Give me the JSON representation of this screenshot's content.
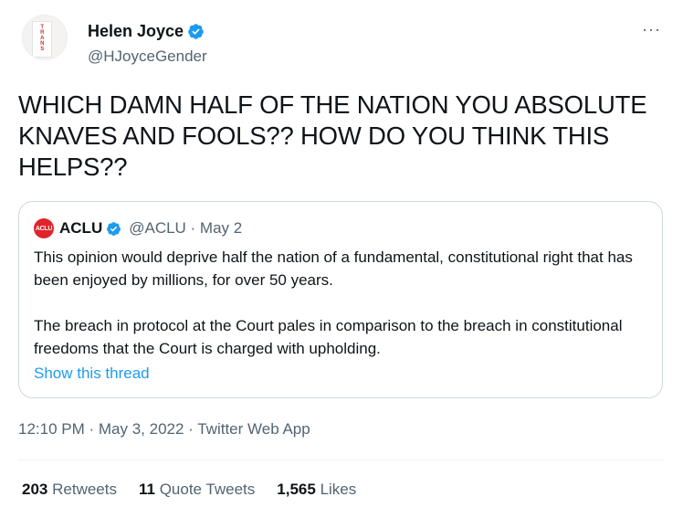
{
  "author": {
    "name": "Helen Joyce",
    "handle": "@HJoyceGender",
    "avatar_text": "TRANS"
  },
  "more_label": "···",
  "tweet": {
    "text": "WHICH DAMN HALF OF THE NATION YOU ABSOLUTE KNAVES AND FOOLS?? HOW DO YOU THINK THIS HELPS??"
  },
  "quoted": {
    "avatar_text": "ACLU",
    "name": "ACLU",
    "handle_date": "@ACLU · May 2",
    "paragraph1": "This opinion would deprive half the nation of a fundamental, constitutional right that has been enjoyed by millions, for over 50 years.",
    "paragraph2": "The breach in protocol at the Court pales in comparison to the breach in constitutional freedoms that the Court is charged with upholding.",
    "show_thread": "Show this thread"
  },
  "meta": "12:10 PM · May 3, 2022 · Twitter Web App",
  "stats": {
    "retweets_count": "203",
    "retweets_label": "Retweets",
    "quotes_count": "11",
    "quotes_label": "Quote Tweets",
    "likes_count": "1,565",
    "likes_label": "Likes"
  },
  "colors": {
    "accent": "#1d9bf0",
    "secondary_text": "#536471",
    "aclu_red": "#e0242b"
  }
}
